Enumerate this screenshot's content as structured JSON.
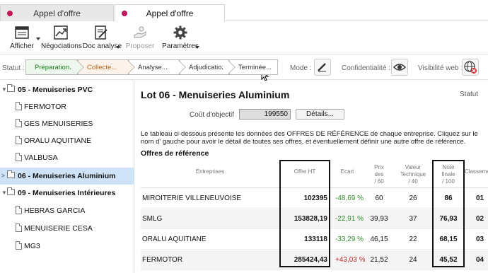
{
  "tabs": [
    {
      "label": "Appel d'offre"
    },
    {
      "label": "Appel d'offre"
    }
  ],
  "toolbar": {
    "afficher": "Afficher",
    "negociations": "Négociations",
    "doc_analyse": "Doc analyse",
    "proposer": "Proposer",
    "parametres": "Paramètres"
  },
  "status": {
    "label": "Statut :",
    "steps": [
      "Préparation...",
      "Collecte...",
      "Analyse...",
      "Adjudication...",
      "Terminée..."
    ],
    "mode_label": "Mode :",
    "confidentiality_label": "Confidentialité :",
    "web_label": "Visibilité web :"
  },
  "sidebar": {
    "items": [
      {
        "label": "05 - Menuiseries PVC"
      },
      {
        "label": "FERMOTOR"
      },
      {
        "label": "GES MENUISERIES"
      },
      {
        "label": "ORALU AQUITIANE"
      },
      {
        "label": "VALBUSA"
      },
      {
        "label": "06 - Menuiseries Aluminium"
      },
      {
        "label": "09 - Menuiseries Intérieures"
      },
      {
        "label": "HEBRAS GARCIA"
      },
      {
        "label": "MENUISERIE CESA"
      },
      {
        "label": "MG3"
      }
    ]
  },
  "main": {
    "title": "Lot 06 - Menuiseries Aluminium",
    "statut": "Statut",
    "cout_label": "Coût d'objectif",
    "cout_value": "199550",
    "details": "Détails...",
    "description": "Le tableau ci-dessous présente les données des OFFRES DE RÉFÉRENCE de chaque entreprise. Cliquez sur le nom d' gauche pour avoir le détail de toutes ses offres, et éventuellement définir une autre offre de référence.",
    "section": "Offres de référence"
  },
  "table": {
    "headers": {
      "entreprises": "Entreprises",
      "offre": "Offre HT",
      "ecart": "Ecart",
      "prix_1": "Prix",
      "prix_2": "des",
      "prix_3": "/ 60",
      "valeur_1": "Valeur",
      "valeur_2": "Technique",
      "valeur_3": "/ 40",
      "note_1": "Note",
      "note_2": "finale",
      "note_3": "/ 100",
      "classement": "Classeme"
    },
    "rows": [
      {
        "name": "MIROITERIE VILLENEUVOISE",
        "offre": "102395",
        "ecart": "-48,69 %",
        "prix": "60",
        "valeur": "26",
        "note": "86",
        "rank": "01"
      },
      {
        "name": "SMLG",
        "offre": "153828,19",
        "ecart": "-22,91 %",
        "prix": "39,93",
        "valeur": "37",
        "note": "76,93",
        "rank": "02"
      },
      {
        "name": "ORALU AQUITIANE",
        "offre": "133118",
        "ecart": "-33,29 %",
        "prix": "46,15",
        "valeur": "22",
        "note": "68,15",
        "rank": "03"
      },
      {
        "name": "FERMOTOR",
        "offre": "285424,43",
        "ecart": "+43,03 %",
        "prix": "21,52",
        "valeur": "24",
        "note": "45,52",
        "rank": "04"
      }
    ]
  },
  "colors": {
    "accent": "#c2185b",
    "selected": "#cfe3f8",
    "positive": "#2e8b2e",
    "negative": "#c62828"
  }
}
